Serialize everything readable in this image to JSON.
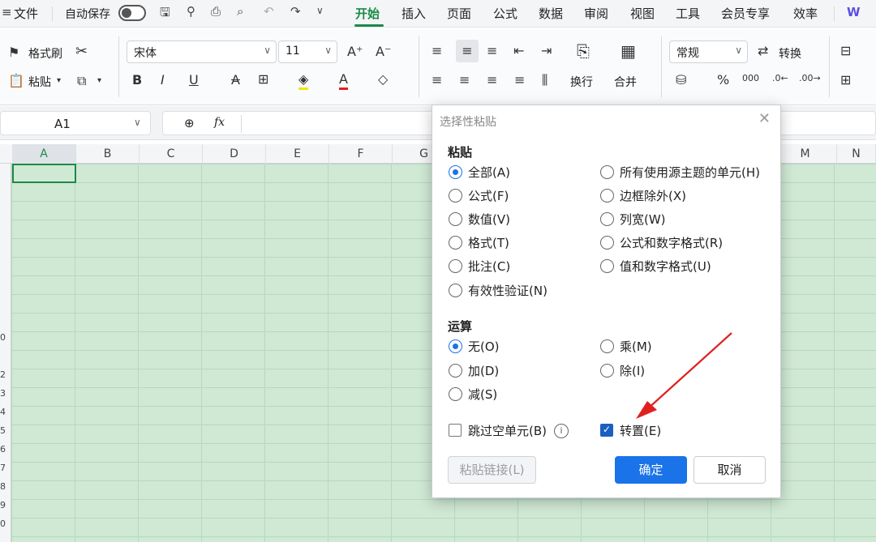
{
  "menubar": {
    "file": "文件",
    "autosave": "自动保存",
    "tabs": [
      "开始",
      "插入",
      "页面",
      "公式",
      "数据",
      "审阅",
      "视图",
      "工具",
      "会员专享",
      "效率"
    ],
    "active_tab": "开始",
    "extra": "W"
  },
  "ribbon": {
    "format_painter": "格式刷",
    "paste": "粘贴",
    "font_name": "宋体",
    "font_size": "11",
    "wrap_text": "换行",
    "merge": "合并",
    "number_format": "常规",
    "convert": "转换",
    "percent": "%",
    "thousands": "000"
  },
  "formula": {
    "cell_ref": "A1",
    "fx": "fx"
  },
  "columns": [
    "A",
    "B",
    "C",
    "D",
    "E",
    "F",
    "G",
    "M",
    "N"
  ],
  "row_numbers": [
    "0",
    "2",
    "3",
    "4",
    "5",
    "6",
    "7",
    "8",
    "9",
    "0"
  ],
  "dialog": {
    "title": "选择性粘贴",
    "paste_section": "粘贴",
    "paste_options_left": [
      "全部(A)",
      "公式(F)",
      "数值(V)",
      "格式(T)",
      "批注(C)",
      "有效性验证(N)"
    ],
    "paste_options_right": [
      "所有使用源主题的单元(H)",
      "边框除外(X)",
      "列宽(W)",
      "公式和数字格式(R)",
      "值和数字格式(U)"
    ],
    "paste_selected": "全部(A)",
    "operation_section": "运算",
    "operation_left": [
      "无(O)",
      "加(D)",
      "减(S)"
    ],
    "operation_right": [
      "乘(M)",
      "除(I)"
    ],
    "operation_selected": "无(O)",
    "skip_blanks": "跳过空单元(B)",
    "skip_blanks_checked": false,
    "transpose": "转置(E)",
    "transpose_checked": true,
    "paste_link": "粘贴链接(L)",
    "ok": "确定",
    "cancel": "取消"
  },
  "colors": {
    "accent_green": "#1b8a47",
    "selection_fill": "#cfe9d4",
    "primary_blue": "#1a73e8",
    "arrow_red": "#e02020"
  }
}
